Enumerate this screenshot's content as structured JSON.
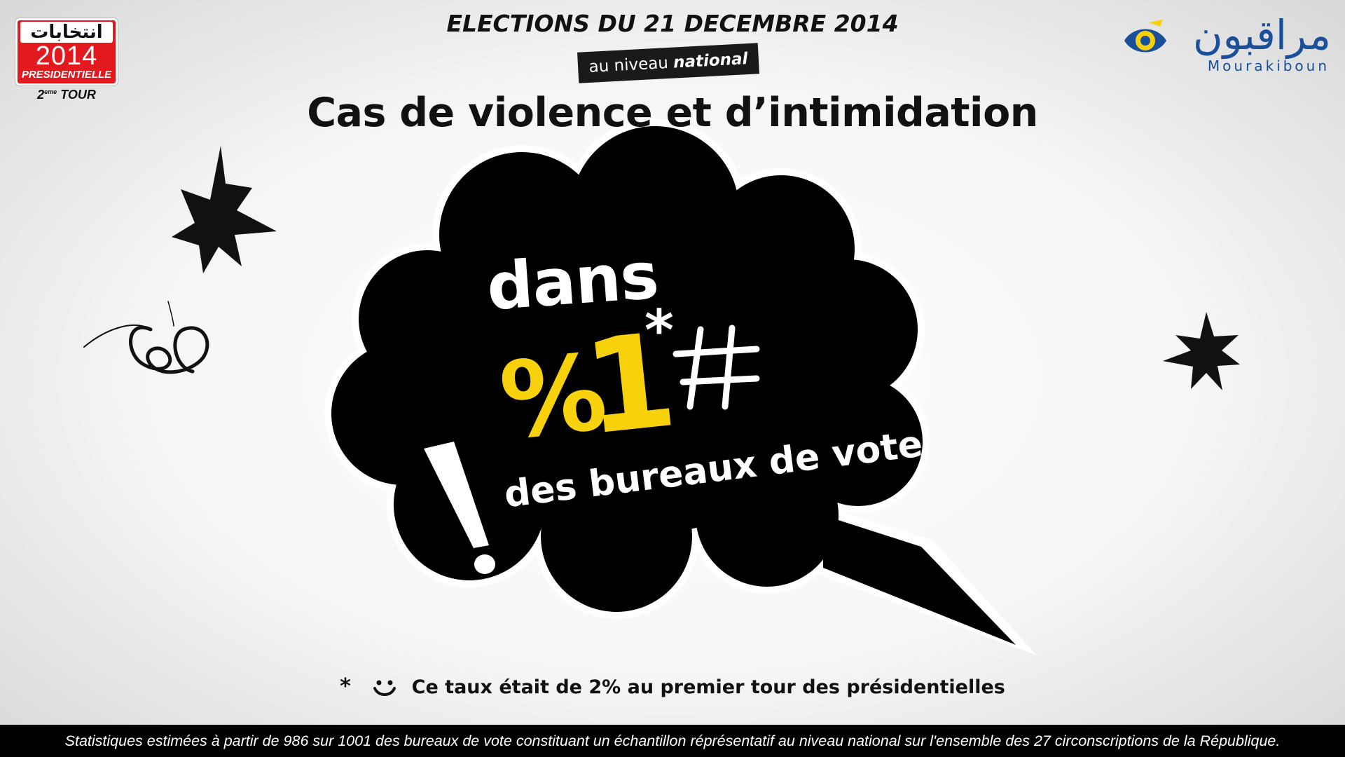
{
  "badge": {
    "arabic_word": "انتخابات",
    "year": "2014",
    "kind": "PRESIDENTIELLE",
    "round_number": "2",
    "round_suffix": "eme",
    "round_word": "TOUR"
  },
  "header": {
    "election_title": "ELECTIONS DU 21 DECEMBRE 2014",
    "level_prefix": "au niveau",
    "level_emphasis": "national",
    "main_title": "Cas de violence et d’intimidation"
  },
  "logo": {
    "arabic_name": "مراقبون",
    "latin_name": "Mourakiboun"
  },
  "bubble": {
    "line1": "dans",
    "percent_symbol": "%",
    "value": "1",
    "asterisk": "*",
    "line3": "des bureaux de vote"
  },
  "footnote": {
    "asterisk": "*",
    "text": "Ce taux était de 2% au premier tour des présidentielles"
  },
  "bottom_bar": {
    "text": "Statistiques estimées à partir de 986 sur 1001 des bureaux de vote constituant un échantillon réprésentatif au niveau national sur l'ensemble des 27 circonscriptions de la République."
  },
  "colors": {
    "bubble": "#000000",
    "accent_yellow": "#f7d10c",
    "badge_red": "#e2191f",
    "logo_blue": "#1a4f9a"
  },
  "icons": [
    "starburst-icon",
    "scribble-icon",
    "hash-icon",
    "exclamation-icon",
    "smile-icon",
    "eye-icon",
    "check-icon"
  ]
}
